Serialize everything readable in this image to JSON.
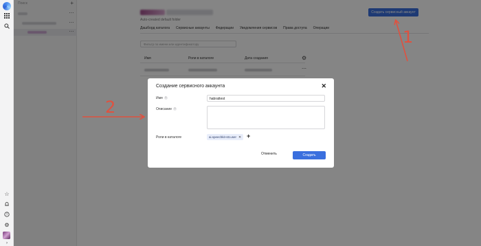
{
  "sidebar": {
    "search_placeholder": "Поиск",
    "add_symbol": "+",
    "row_menu": "⋯"
  },
  "header": {
    "subtitle": "Auto-created default folder",
    "create_button": "Создать сервисный аккаунт"
  },
  "tabs": [
    {
      "label": "Дашборд каталога"
    },
    {
      "label": "Сервисные аккаунты"
    },
    {
      "label": "Федерации"
    },
    {
      "label": "Уведомления сервисов"
    },
    {
      "label": "Права доступа"
    },
    {
      "label": "Операции"
    }
  ],
  "filter": {
    "placeholder": "Фильтр по имени или идентификатору"
  },
  "table": {
    "columns": [
      "Имя",
      "Роли в каталоге",
      "Дата создания"
    ],
    "row_menu": "⋯"
  },
  "modal": {
    "title": "Создание сервисного аккаунта",
    "close": "✕",
    "name_label": "Имя",
    "name_value": "habrattest",
    "description_label": "Описание",
    "description_value": "",
    "roles_label": "Роли в каталоге",
    "role_chip": "ai.speechkit-stt.user",
    "role_chip_remove": "✕",
    "add_role": "+",
    "cancel_button": "Отменить",
    "submit_button": "Создать",
    "hint": "?"
  },
  "annotations": {
    "label_1": "1",
    "label_2": "2",
    "color": "#e0513f"
  },
  "colors": {
    "primary": "#3a6fde",
    "overlay": "rgba(0,0,0,0.48)"
  }
}
